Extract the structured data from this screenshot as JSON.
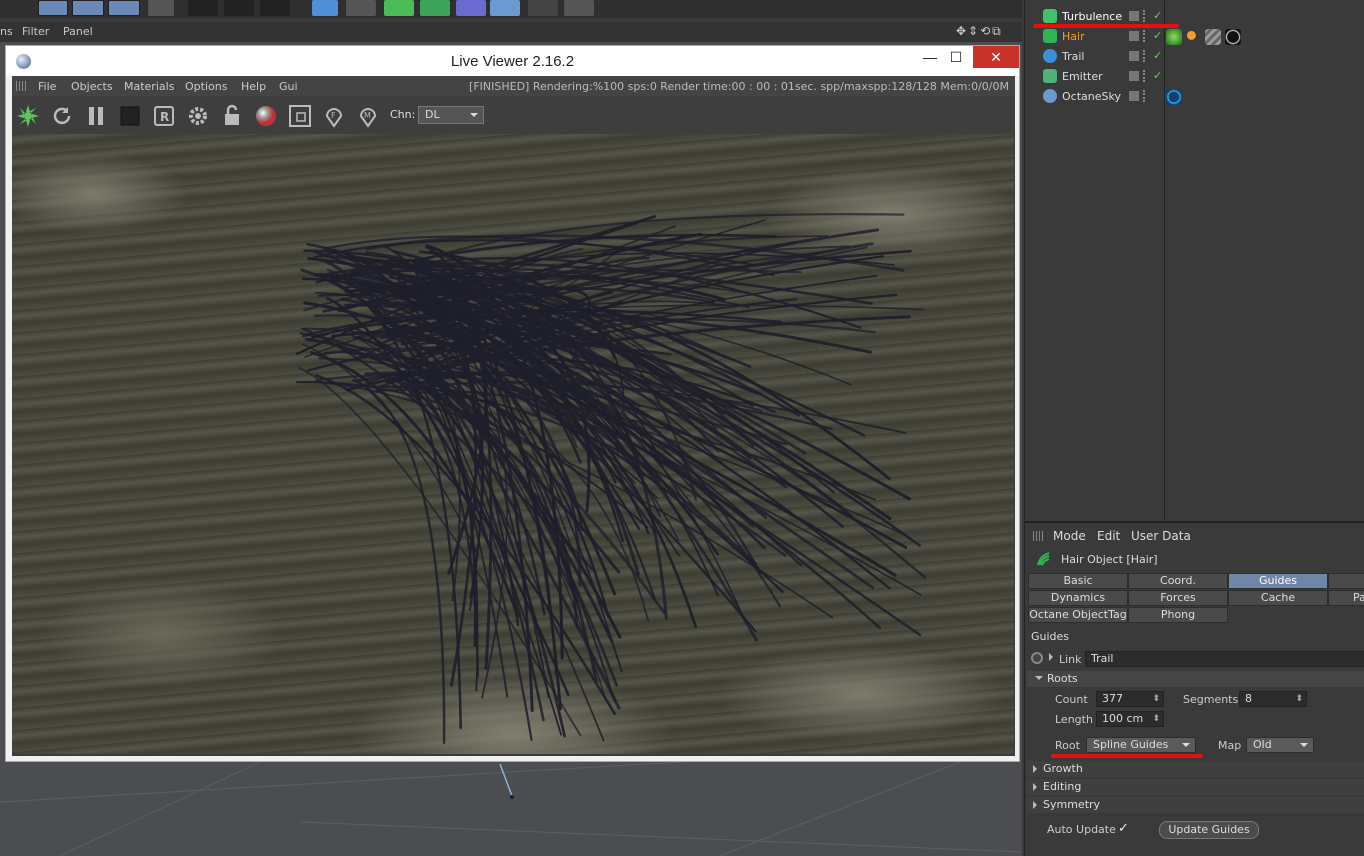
{
  "main_menu": {
    "items": [
      "ns",
      "Filter",
      "Panel"
    ]
  },
  "live_viewer": {
    "title": "Live Viewer 2.16.2",
    "window_buttons": {
      "minimize": "—",
      "maximize": "☐",
      "close": "✕"
    },
    "menu": [
      "File",
      "Objects",
      "Materials",
      "Options",
      "Help",
      "Gui"
    ],
    "status": "[FINISHED]  Rendering:%100 sps:0 Render time:00 : 00 : 01sec. spp/maxspp:128/128 Mem:0/0/0M",
    "channel_label": "Chn:",
    "channel_value": "DL"
  },
  "object_manager": {
    "objects": [
      {
        "name": "Turbulence",
        "color": "#ffffff",
        "icon": "turbulence-icon"
      },
      {
        "name": "Hair",
        "color": "#f0a020",
        "icon": "hair-icon"
      },
      {
        "name": "Trail",
        "color": "#dddddd",
        "icon": "trail-icon"
      },
      {
        "name": "Emitter",
        "color": "#dddddd",
        "icon": "emitter-icon"
      },
      {
        "name": "OctaneSky",
        "color": "#dddddd",
        "icon": "sky-icon"
      }
    ]
  },
  "attribute_manager": {
    "menu": [
      "Mode",
      "Edit",
      "User Data"
    ],
    "title": "Hair Object [Hair]",
    "tabs_row1": [
      "Basic",
      "Coord.",
      "Guides",
      ""
    ],
    "tabs_row2": [
      "Dynamics",
      "Forces",
      "Cache",
      "Pa"
    ],
    "tabs_row3": [
      "Octane ObjectTag",
      "Phong"
    ],
    "active_tab": "Guides",
    "section_title": "Guides",
    "link_label": "Link",
    "link_value": "Trail",
    "roots_title": "Roots",
    "count_label": "Count",
    "count_value": "377",
    "segments_label": "Segments",
    "segments_value": "8",
    "length_label": "Length",
    "length_value": "100 cm",
    "root_label": "Root",
    "root_value": "Spline Guides",
    "map_label": "Map",
    "map_value": "Old",
    "collapsed_sections": [
      "Growth",
      "Editing",
      "Symmetry"
    ],
    "auto_update_label": "Auto Update",
    "auto_update_check": "✓",
    "update_guides_label": "Update Guides"
  },
  "colors": {
    "accent": "#6e86a8",
    "annotation": "#e31010",
    "hair_strands": "#1e1f2b"
  }
}
